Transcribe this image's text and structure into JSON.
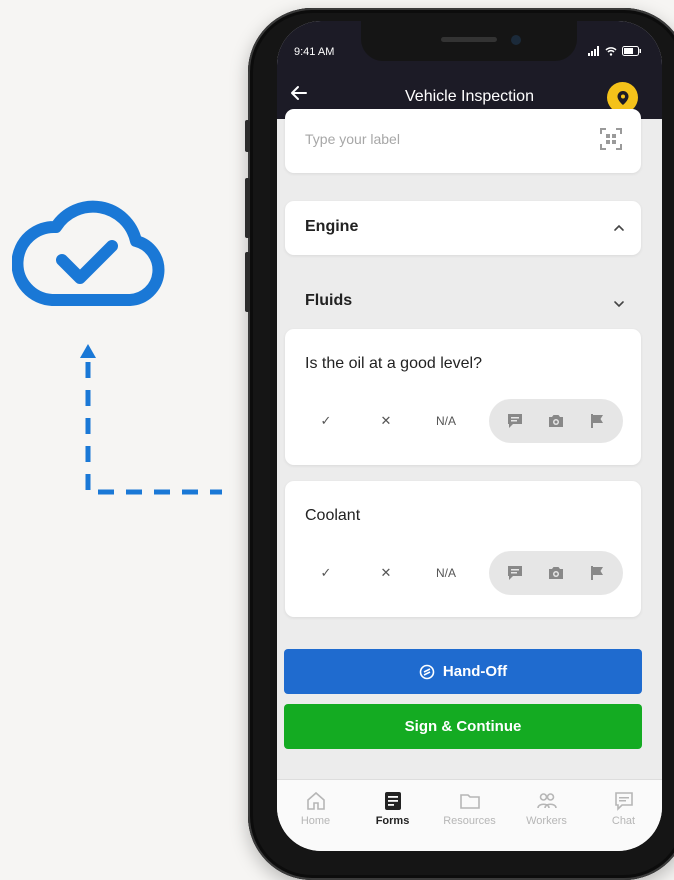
{
  "colors": {
    "accent_blue": "#1f6bcf",
    "success_green": "#14ab22",
    "header_bg": "#1c1b26",
    "pin_yellow": "#f4c21a",
    "cloud_blue": "#1a78d6"
  },
  "status_bar": {
    "time": "9:41 AM"
  },
  "header": {
    "title": "Vehicle Inspection",
    "back_icon": "arrow-left-icon",
    "location_icon": "map-pin-icon"
  },
  "label_field": {
    "placeholder": "Type your label",
    "scan_icon": "qr-scan-icon"
  },
  "sections": {
    "engine": "Engine",
    "fluids": "Fluids"
  },
  "questions": [
    {
      "text": "Is the oil at a good level?",
      "yes": "✓",
      "no": "✕",
      "na": "N/A"
    },
    {
      "text": "Coolant",
      "yes": "✓",
      "no": "✕",
      "na": "N/A"
    }
  ],
  "buttons": {
    "handoff": "Hand-Off",
    "sign": "Sign & Continue"
  },
  "tabs": [
    {
      "label": "Home",
      "icon": "home-icon"
    },
    {
      "label": "Forms",
      "icon": "forms-icon"
    },
    {
      "label": "Resources",
      "icon": "folder-icon"
    },
    {
      "label": "Workers",
      "icon": "workers-icon"
    },
    {
      "label": "Chat",
      "icon": "chat-icon"
    }
  ]
}
